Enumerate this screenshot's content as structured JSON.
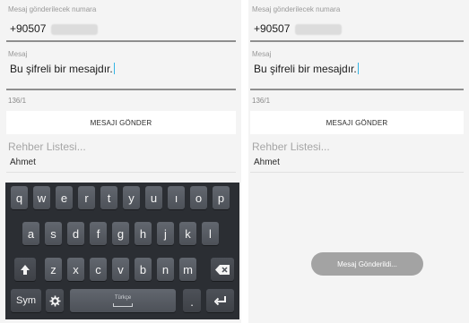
{
  "left": {
    "number_label": "Mesaj gönderilecek numara",
    "number_value": "+90507",
    "message_label": "Mesaj",
    "message_value": "Bu şifreli bir mesajdır.",
    "counter": "136/1",
    "send_button": "MESAJI GÖNDER",
    "contacts_title": "Rehber Listesi...",
    "contact_name": "Ahmet"
  },
  "right": {
    "number_label": "Mesaj gönderilecek numara",
    "number_value": "+90507",
    "message_label": "Mesaj",
    "message_value": "Bu şifreli bir mesajdır.",
    "counter": "136/1",
    "send_button": "MESAJI GÖNDER",
    "contacts_title": "Rehber Listesi...",
    "contact_name": "Ahmet",
    "toast": "Mesaj Gönderildi..."
  },
  "keyboard": {
    "row1": [
      "q",
      "w",
      "e",
      "r",
      "t",
      "y",
      "u",
      "ı",
      "o",
      "p"
    ],
    "row2": [
      "a",
      "s",
      "d",
      "f",
      "g",
      "h",
      "j",
      "k",
      "l"
    ],
    "row3": [
      "z",
      "x",
      "c",
      "v",
      "b",
      "n",
      "m"
    ],
    "sym_label": "Sym",
    "space_label": "Türkçe",
    "dot_label": "."
  }
}
